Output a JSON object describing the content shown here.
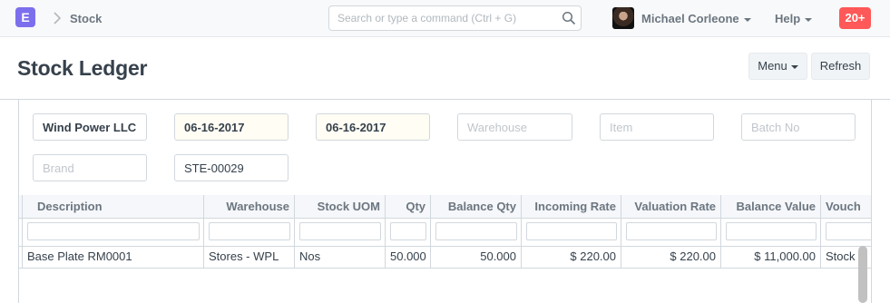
{
  "navbar": {
    "logo_letter": "E",
    "breadcrumb": "Stock",
    "search_placeholder": "Search or type a command (Ctrl + G)",
    "user_name": "Michael Corleone",
    "help_label": "Help",
    "notification_count": "20+"
  },
  "page": {
    "title": "Stock Ledger",
    "menu_label": "Menu",
    "refresh_label": "Refresh"
  },
  "filters": {
    "company": "Wind Power LLC",
    "from_date": "06-16-2017",
    "to_date": "06-16-2017",
    "warehouse_placeholder": "Warehouse",
    "item_placeholder": "Item",
    "batch_placeholder": "Batch No",
    "brand_placeholder": "Brand",
    "voucher_no": "STE-00029"
  },
  "table": {
    "columns": [
      "Description",
      "Warehouse",
      "Stock UOM",
      "Qty",
      "Balance Qty",
      "Incoming Rate",
      "Valuation Rate",
      "Balance Value",
      "Vouch"
    ],
    "rows": [
      [
        "Base Plate RM0001",
        "Stores - WPL",
        "Nos",
        "50.000",
        "50.000",
        "$ 220.00",
        "$ 220.00",
        "$ 11,000.00",
        "Stock"
      ]
    ]
  }
}
